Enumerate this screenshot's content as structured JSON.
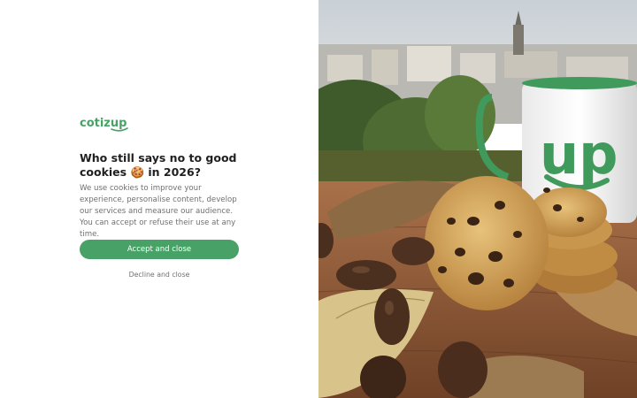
{
  "brand": {
    "logo_text_prefix": "cotiz",
    "logo_text_suffix": "up",
    "accent_color": "#48a267"
  },
  "dialog": {
    "title_line1": "Who still says no to good",
    "title_line2": "cookies 🍪 in 2026?",
    "description": "We use cookies to improve your experience, personalise content, develop our services and measure our audience. You can accept or refuse their use at any time.",
    "accept_label": "Accept and close",
    "decline_label": "Decline and close"
  },
  "photo": {
    "mug_text": "up"
  }
}
